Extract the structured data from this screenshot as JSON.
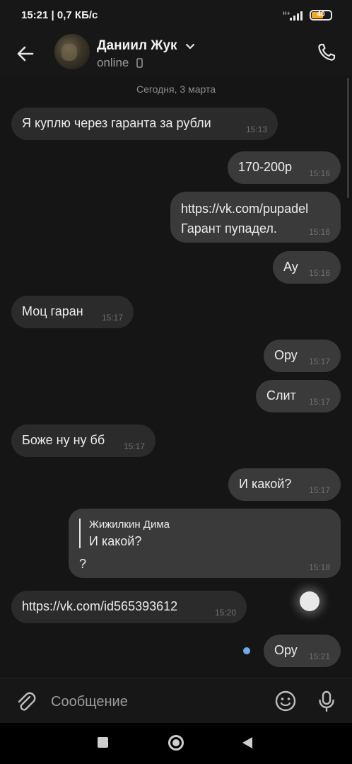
{
  "status_bar": {
    "text": "15:21 | 0,7 КБ/с",
    "battery": "40",
    "network": "H+"
  },
  "header": {
    "back_icon": "arrow-left-icon",
    "contact_name": "Даниил Жук",
    "status": "online",
    "call_icon": "phone-icon"
  },
  "chat": {
    "date": "Сегодня, 3 марта",
    "messages": [
      {
        "dir": "in",
        "text": "Я куплю через гаранта за рубли",
        "time": "15:13"
      },
      {
        "dir": "out",
        "text": "170-200р",
        "time": "15:16"
      },
      {
        "dir": "out",
        "link": "https://vk.com/pupadel",
        "text": "Гарант пупадел.",
        "time": "15:16"
      },
      {
        "dir": "out",
        "text": "Ау",
        "time": "15:16"
      },
      {
        "dir": "in",
        "text": "Моц гаран",
        "time": "15:17"
      },
      {
        "dir": "out",
        "text": "Ору",
        "time": "15:17"
      },
      {
        "dir": "out",
        "text": "Слит",
        "time": "15:17"
      },
      {
        "dir": "in",
        "text": "Боже ну ну бб",
        "time": "15:17"
      },
      {
        "dir": "out",
        "text": "И какой?",
        "time": "15:17"
      },
      {
        "dir": "out",
        "reply_author": "Жижилкин Дима",
        "reply_text": "И какой?",
        "text": "?",
        "time": "15:18"
      },
      {
        "dir": "in",
        "link": "https://vk.com/id565393612",
        "time": "15:20"
      },
      {
        "dir": "out",
        "text": "Ору",
        "time": "15:21"
      }
    ]
  },
  "composer": {
    "placeholder": "Сообщение",
    "attach_icon": "paperclip-icon",
    "emoji_icon": "smile-icon",
    "mic_icon": "microphone-icon"
  },
  "colors": {
    "background": "#151515",
    "bubble_in": "#2b2b2b",
    "bubble_out": "#3a3a3a",
    "link": "#71aaeb"
  }
}
